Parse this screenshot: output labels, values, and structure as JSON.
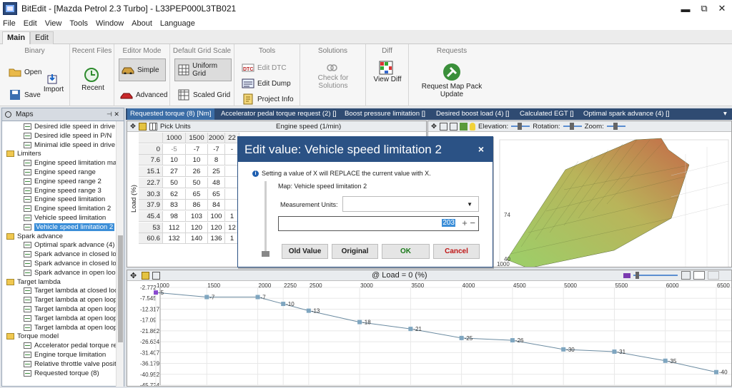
{
  "window": {
    "title": "BitEdit - [Mazda Petrol 2.3 Turbo] - L33PEP000L3TB021",
    "minimize": "▬",
    "restore": "⧉",
    "close": "✕"
  },
  "menu": [
    "File",
    "Edit",
    "View",
    "Tools",
    "Window",
    "About",
    "Language"
  ],
  "ribbon_tabs": [
    "Main",
    "Edit"
  ],
  "ribbon": {
    "binary": {
      "title": "Binary",
      "open": "Open",
      "import": "Import",
      "save": "Save"
    },
    "recent_files": {
      "title": "Recent Files",
      "recent": "Recent"
    },
    "editor_mode": {
      "title": "Editor Mode",
      "simple": "Simple",
      "advanced": "Advanced"
    },
    "grid_scale": {
      "title": "Default Grid Scale",
      "uniform": "Uniform Grid",
      "scaled": "Scaled Grid"
    },
    "tools": {
      "title": "Tools",
      "edit_dtc": "Edit DTC",
      "edit_dump": "Edit Dump",
      "project_info": "Project Info"
    },
    "solutions": {
      "title": "Solutions",
      "check": "Check for Solutions"
    },
    "diff": {
      "title": "Diff",
      "view": "View Diff"
    },
    "requests": {
      "title": "Requests",
      "map_pack": "Request Map Pack Update"
    }
  },
  "maps_panel": {
    "title": "Maps",
    "pin": "⊣ ✕",
    "tree": [
      {
        "label": "Desired idle speed in drive",
        "type": "map",
        "indent": 2
      },
      {
        "label": "Desired idle speed in P/N",
        "type": "map",
        "indent": 2
      },
      {
        "label": "Minimal idle speed in drive",
        "type": "map",
        "indent": 2
      },
      {
        "label": "Limiters",
        "type": "folder",
        "indent": 1
      },
      {
        "label": "Engine speed limitation main",
        "type": "map",
        "indent": 2
      },
      {
        "label": "Engine speed range",
        "type": "map",
        "indent": 2
      },
      {
        "label": "Engine speed range 2",
        "type": "map",
        "indent": 2
      },
      {
        "label": "Engine speed range 3",
        "type": "map",
        "indent": 2
      },
      {
        "label": "Engine speed limitation",
        "type": "map",
        "indent": 2
      },
      {
        "label": "Engine speed limitation 2",
        "type": "map",
        "indent": 2
      },
      {
        "label": "Vehicle speed limitation",
        "type": "map",
        "indent": 2
      },
      {
        "label": "Vehicle speed limitation 2",
        "type": "map",
        "indent": 2,
        "selected": true
      },
      {
        "label": "Spark advance",
        "type": "folder",
        "indent": 1
      },
      {
        "label": "Optimal spark advance (4)",
        "type": "map",
        "indent": 2
      },
      {
        "label": "Spark advance in closed loop",
        "type": "map",
        "indent": 2
      },
      {
        "label": "Spark advance in closed loop",
        "type": "map",
        "indent": 2
      },
      {
        "label": "Spark advance in open loop m",
        "type": "map",
        "indent": 2
      },
      {
        "label": "Target lambda",
        "type": "folder",
        "indent": 1
      },
      {
        "label": "Target lambda at closed loop",
        "type": "map",
        "indent": 2
      },
      {
        "label": "Target lambda at open loop 1",
        "type": "map",
        "indent": 2
      },
      {
        "label": "Target lambda at open loop 2",
        "type": "map",
        "indent": 2
      },
      {
        "label": "Target lambda at open loop 3",
        "type": "map",
        "indent": 2
      },
      {
        "label": "Target lambda at open loop 4",
        "type": "map",
        "indent": 2
      },
      {
        "label": "Torque model",
        "type": "folder",
        "indent": 1
      },
      {
        "label": "Accelerator pedal torque requ",
        "type": "map",
        "indent": 2
      },
      {
        "label": "Engine torque limitation",
        "type": "map",
        "indent": 2
      },
      {
        "label": "Relative throttle valve positior",
        "type": "map",
        "indent": 2
      },
      {
        "label": "Requested torque (8)",
        "type": "map",
        "indent": 2
      }
    ]
  },
  "doc_tabs": [
    "Requested torque (8) [Nm]",
    "Accelerator pedal torque request (2) []",
    "Boost pressure limitation []",
    "Desired boost load (4) []",
    "Calculated EGT []",
    "Optimal spark advance (4) []"
  ],
  "doc_tabs_menu": "▾",
  "grid_panel": {
    "toolbar_label": "Pick Units",
    "x_axis_label": "Engine speed (1/min)",
    "y_axis_label": "Load (%)",
    "col_headers": [
      "1000",
      "1500",
      "2000",
      "22"
    ],
    "rows": [
      {
        "load": "0",
        "cells": [
          "-5",
          "-7",
          "-7",
          "-"
        ]
      },
      {
        "load": "7.6",
        "cells": [
          "10",
          "10",
          "8",
          ""
        ]
      },
      {
        "load": "15.1",
        "cells": [
          "27",
          "26",
          "25",
          ""
        ]
      },
      {
        "load": "22.7",
        "cells": [
          "50",
          "50",
          "48",
          ""
        ]
      },
      {
        "load": "30.3",
        "cells": [
          "62",
          "65",
          "65",
          ""
        ]
      },
      {
        "load": "37.9",
        "cells": [
          "83",
          "86",
          "84",
          ""
        ]
      },
      {
        "load": "45.4",
        "cells": [
          "98",
          "103",
          "100",
          "1"
        ]
      },
      {
        "load": "53",
        "cells": [
          "112",
          "120",
          "120",
          "12"
        ]
      },
      {
        "load": "60.6",
        "cells": [
          "132",
          "140",
          "136",
          "1"
        ]
      }
    ]
  },
  "graph3d": {
    "elevation_label": "Elevation:",
    "rotation_label": "Rotation:",
    "zoom_label": "Zoom:",
    "axis_ticks": [
      "74",
      "40",
      "1000"
    ]
  },
  "graph2d": {
    "title": "@ Load = 0 (%)",
    "chart_data": {
      "type": "line",
      "x": [
        1000,
        1500,
        2000,
        2250,
        2500,
        3000,
        3500,
        4000,
        4500,
        5000,
        5500,
        6000,
        6500
      ],
      "values": [
        -5,
        -7,
        -7,
        -10,
        -13,
        -18,
        -21,
        -25,
        -26,
        -30,
        -31,
        -35,
        -40
      ],
      "y_ticks": [
        "-2.772",
        "-7.545",
        "-12.317",
        "-17.09",
        "-21.862",
        "-26.634",
        "-31.407",
        "-36.179",
        "-40.952",
        "-45.724"
      ],
      "x_ticks": [
        "1000",
        "1500",
        "2000",
        "2250",
        "2500",
        "3000",
        "3500",
        "4000",
        "4500",
        "5000",
        "5500",
        "6000",
        "6500"
      ],
      "ylim": [
        -45.724,
        -2.772
      ]
    }
  },
  "dialog": {
    "title": "Edit value: Vehicle speed limitation 2",
    "close": "×",
    "info_text": "Setting a value of X will REPLACE the current value with X.",
    "map_text": "Map: Vehicle speed limitation 2",
    "units_label": "Measurement Units:",
    "units_value": "",
    "value": "203",
    "plus_minus": "+ −",
    "buttons": {
      "old": "Old Value",
      "original": "Original",
      "ok": "OK",
      "cancel": "Cancel"
    }
  }
}
